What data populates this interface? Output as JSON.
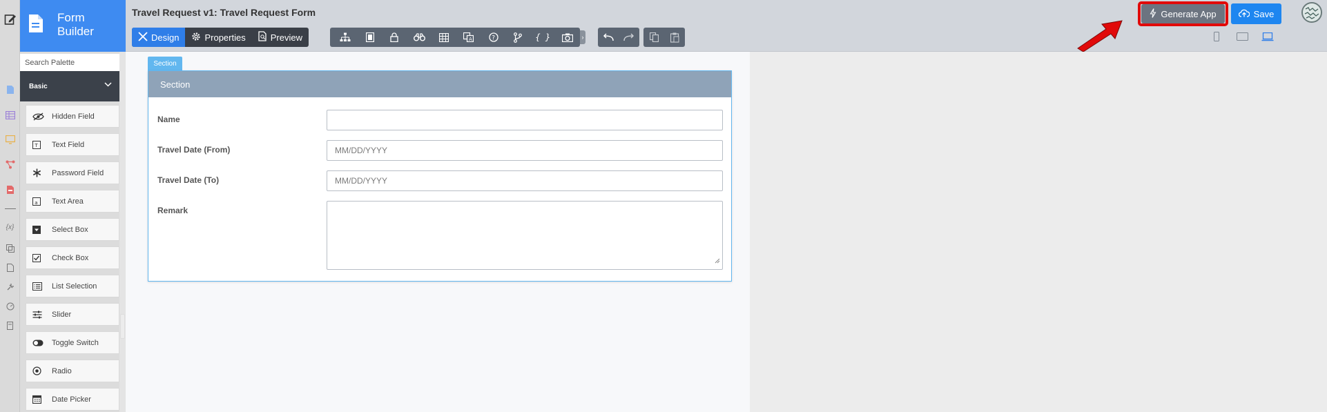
{
  "brand": {
    "title": "Form Builder"
  },
  "header": {
    "form_title": "Travel Request v1: Travel Request Form",
    "tabs": [
      {
        "label": "Design",
        "icon": "design-icon",
        "active": true
      },
      {
        "label": "Properties",
        "icon": "gear-icon",
        "active": false
      },
      {
        "label": "Preview",
        "icon": "preview-icon",
        "active": false
      }
    ],
    "toolbar_icons": [
      "sitemap-icon",
      "sql-icon",
      "lock-icon",
      "binoculars-icon",
      "table-icon",
      "translate-icon",
      "help-icon",
      "branch-icon",
      "variable-icon",
      "camera-icon"
    ],
    "generate_label": "Generate App",
    "save_label": "Save",
    "accent_color": "#3e8bf1",
    "highlight_color": "#e10a0a"
  },
  "palette": {
    "search_placeholder": "Search Palette",
    "category": "Basic",
    "items": [
      {
        "label": "Hidden Field",
        "icon": "hidden-eye-icon"
      },
      {
        "label": "Text Field",
        "icon": "text-field-icon"
      },
      {
        "label": "Password Field",
        "icon": "asterisk-icon"
      },
      {
        "label": "Text Area",
        "icon": "text-area-icon"
      },
      {
        "label": "Select Box",
        "icon": "select-box-icon"
      },
      {
        "label": "Check Box",
        "icon": "checkbox-icon"
      },
      {
        "label": "List Selection",
        "icon": "list-icon"
      },
      {
        "label": "Slider",
        "icon": "slider-icon"
      },
      {
        "label": "Toggle Switch",
        "icon": "toggle-icon"
      },
      {
        "label": "Radio",
        "icon": "radio-icon"
      },
      {
        "label": "Date Picker",
        "icon": "calendar-icon"
      }
    ]
  },
  "canvas": {
    "section_tag": "Section",
    "section_title": "Section",
    "fields": [
      {
        "label": "Name",
        "placeholder": "",
        "value": ""
      },
      {
        "label": "Travel Date (From)",
        "placeholder": "MM/DD/YYYY",
        "value": ""
      },
      {
        "label": "Travel Date (To)",
        "placeholder": "MM/DD/YYYY",
        "value": ""
      },
      {
        "label": "Remark",
        "placeholder": "",
        "value": ""
      }
    ]
  }
}
